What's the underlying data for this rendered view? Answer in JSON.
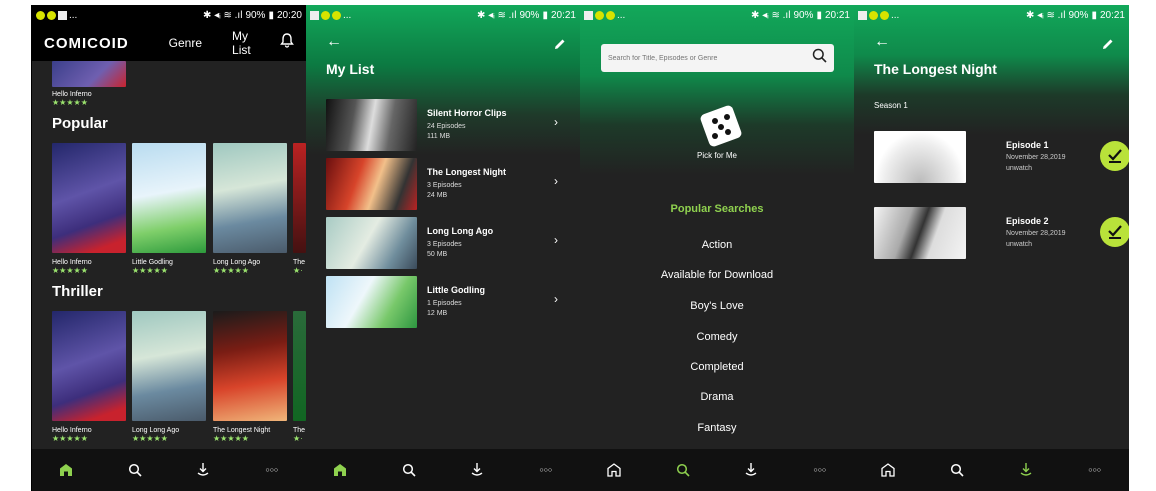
{
  "status": {
    "s1": {
      "signal": "✱ ◂ᵢ ≋ .ıl",
      "battery": "90%",
      "time": "20:20"
    },
    "s2": {
      "signal": "✱ ◂ᵢ ≋ .ıl",
      "battery": "90%",
      "time": "20:21"
    },
    "s3": {
      "signal": "✱ ◂ᵢ ≋ .ıl",
      "battery": "90%",
      "time": "20:21"
    },
    "s4": {
      "signal": "✱ ◂ᵢ ≋ .ıl",
      "battery": "90%",
      "time": "20:21"
    },
    "ellipsis": "..."
  },
  "home": {
    "logo": "COMICOID",
    "genre": "Genre",
    "mylist": "My List",
    "top_item": "Hello Inferno",
    "sections": [
      {
        "title": "Popular",
        "items": [
          "Hello Inferno",
          "Little Godling",
          "Long Long Ago",
          "The"
        ]
      },
      {
        "title": "Thriller",
        "items": [
          "Hello Inferno",
          "Long Long Ago",
          "The Longest Night",
          "The"
        ]
      }
    ],
    "stars": "★★★★★",
    "stars_partial": "★·"
  },
  "mylist": {
    "title": "My List",
    "back": "←",
    "items": [
      {
        "title": "Silent Horror Clips",
        "episodes": "24 Episodes",
        "size": "111 MB"
      },
      {
        "title": "The Longest Night",
        "episodes": "3 Episodes",
        "size": "24 MB"
      },
      {
        "title": "Long Long Ago",
        "episodes": "3 Episodes",
        "size": "50 MB"
      },
      {
        "title": "Little Godling",
        "episodes": "1 Episodes",
        "size": "12 MB"
      }
    ],
    "chevron": "›"
  },
  "search": {
    "placeholder": "Search for Title, Episodes or Genre",
    "pick": "Pick for Me",
    "popular_title": "Popular Searches",
    "popular": [
      "Action",
      "Available for Download",
      "Boy's Love",
      "Comedy",
      "Completed",
      "Drama",
      "Fantasy"
    ]
  },
  "detail": {
    "back": "←",
    "title": "The Longest Night",
    "season": "Season 1",
    "episodes": [
      {
        "title": "Episode 1",
        "date": "November 28,2019",
        "status": "unwatch"
      },
      {
        "title": "Episode 2",
        "date": "November 28,2019",
        "status": "unwatch"
      }
    ]
  },
  "nav": {
    "more": "○○○"
  },
  "colors": {
    "accent": "#8fd14f",
    "green": "#12a85a",
    "check": "#b9e23a",
    "bg": "#222222"
  }
}
